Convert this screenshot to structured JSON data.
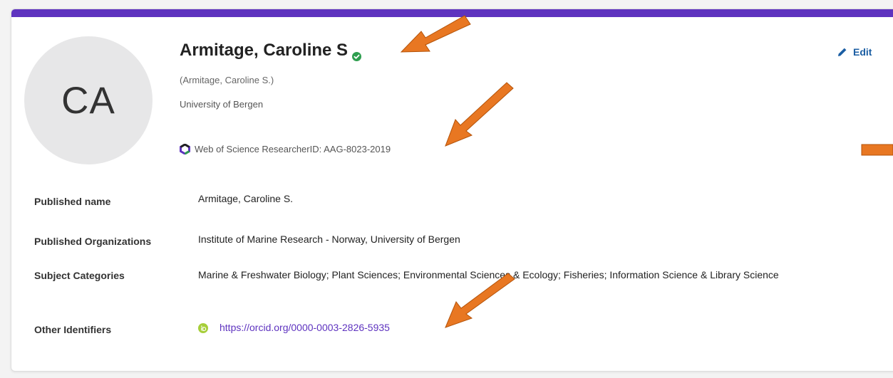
{
  "profile": {
    "initials": "CA",
    "name": "Armitage, Caroline S",
    "alt_name": "(Armitage, Caroline S.)",
    "organization": "University of Bergen",
    "researcher_id": "Web of Science ResearcherID: AAG-8023-2019",
    "edit_label": "Edit"
  },
  "details": {
    "rows": [
      {
        "label": "Published name",
        "value": "Armitage, Caroline S."
      },
      {
        "label": "Published Organizations",
        "value": "Institute of Marine Research - Norway,  University of Bergen"
      },
      {
        "label": "Subject Categories",
        "value": "Marine & Freshwater Biology;  Plant Sciences;  Environmental Sciences & Ecology;  Fisheries;  Information Science & Library Science"
      },
      {
        "label": "Other Identifiers",
        "value": "https://orcid.org/0000-0003-2826-5935"
      }
    ]
  },
  "colors": {
    "accent_bar": "#5e33bf",
    "link": "#5e33bf",
    "edit": "#1b5ea3",
    "verified": "#2e9e4f",
    "annotation_arrow": "#e87722"
  },
  "icons": [
    "verified-check-icon",
    "researcherid-logo-icon",
    "pencil-icon",
    "orcid-icon",
    "annotation-arrow"
  ]
}
